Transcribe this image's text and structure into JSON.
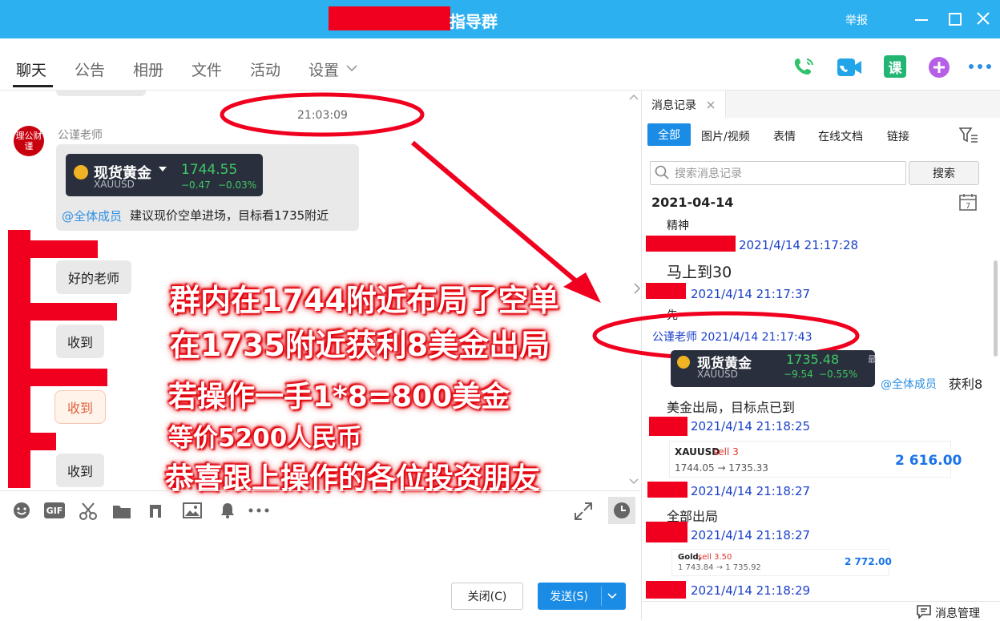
{
  "titlebar": {
    "title": "指导群",
    "report": "举报"
  },
  "tabs": [
    "聊天",
    "公告",
    "相册",
    "文件",
    "活动",
    "设置"
  ],
  "chat": {
    "timestamp": "21:03:09",
    "sender_name": "公谨老师",
    "avatar_text": "理公财谨",
    "quote": {
      "name": "现货黄金",
      "symbol": "XAUUSD",
      "price": "1744.55",
      "change": "−0.47",
      "change_pct": "−0.03%"
    },
    "mention": "@全体成员",
    "message": "建议现价空单进场，目标看1735附近",
    "replies": [
      "好的老师",
      "收到",
      "收到",
      "收到"
    ]
  },
  "overlay": {
    "line1": "群内在1744附近布局了空单",
    "line2": "在1735附近获利8美金出局",
    "line3": "若操作一手1*8=800美金",
    "line4": "等价5200人民币",
    "line5": "恭喜跟上操作的各位投资朋友"
  },
  "composer": {
    "close_label": "关闭(C)",
    "send_label": "发送(S)"
  },
  "history": {
    "tab_title": "消息记录",
    "filters": [
      "全部",
      "图片/视频",
      "表情",
      "在线文档",
      "链接"
    ],
    "search_placeholder": "搜索消息记录",
    "search_button": "搜索",
    "date": "2021-04-14",
    "items": {
      "t0": "精神",
      "ts1": "2021/4/14 21:17:28",
      "t1": "马上到30",
      "ts2": "2021/4/14 21:17:37",
      "t2": "先",
      "ts3": "公谨老师 2021/4/14 21:17:43",
      "quote_name": "现货黄金",
      "quote_symbol": "XAUUSD",
      "quote_price": "1735.48",
      "quote_change": "−9.54",
      "quote_pct": "−0.55%",
      "quote_side": "最",
      "mention": "@全体成员",
      "mention_text": "获利8",
      "t3": "美金出局，目标点已到",
      "ts4": "2021/4/14 21:18:25",
      "card1_title": "XAUUSD",
      "card1_side": "sell 3",
      "card1_range": "1744.05 → 1735.33",
      "card1_profit": "2 616.00",
      "ts5": "2021/4/14 21:18:27",
      "t4": "全部出局",
      "ts6": "2021/4/14 21:18:27",
      "card2_title": "Gold,",
      "card2_side": "sell 3.50",
      "card2_range": "1 743.84 → 1 735.92",
      "card2_profit": "2 772.00",
      "ts7": "2021/4/14 21:18:29"
    },
    "manage_label": "消息管理"
  },
  "colors": {
    "titlebar": "#2db0ef",
    "accent": "#1a8ce6",
    "redact": "#f0001e",
    "up_green": "#3ec965"
  }
}
